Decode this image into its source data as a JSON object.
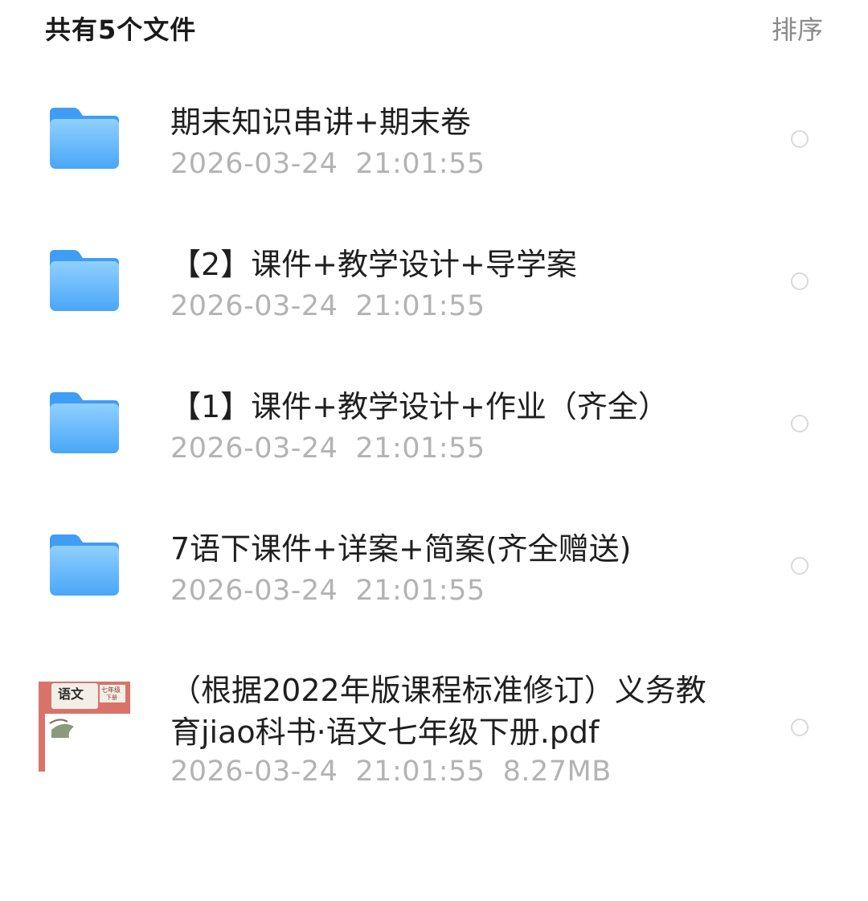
{
  "header": {
    "title": "共有5个文件",
    "sort_label": "排序"
  },
  "colors": {
    "folder_light": "#8fd0ff",
    "folder_dark": "#3f9df5",
    "meta_text": "#b3b3b3",
    "radio_border": "#d9d9d9"
  },
  "files": [
    {
      "type": "folder",
      "icon": "folder-icon",
      "name": "期末知识串讲+期末卷",
      "date": "2026-03-24",
      "time": "21:01:55"
    },
    {
      "type": "folder",
      "icon": "folder-icon",
      "name": "【2】课件+教学设计+导学案",
      "date": "2026-03-24",
      "time": "21:01:55"
    },
    {
      "type": "folder",
      "icon": "folder-icon",
      "name": "【1】课件+教学设计+作业（齐全）",
      "date": "2026-03-24",
      "time": "21:01:55"
    },
    {
      "type": "folder",
      "icon": "folder-icon",
      "name": "7语下课件+详案+简案(齐全赠送)",
      "date": "2026-03-24",
      "time": "21:01:55"
    },
    {
      "type": "pdf",
      "icon": "pdf-thumbnail",
      "name": "（根据2022年版课程标准修订）义务教育jiao科书·语文七年级下册.pdf",
      "date": "2026-03-24",
      "time": "21:01:55",
      "size": "8.27MB",
      "thumb_title": "语文",
      "thumb_grade": "七年级",
      "thumb_volume": "下册"
    }
  ]
}
